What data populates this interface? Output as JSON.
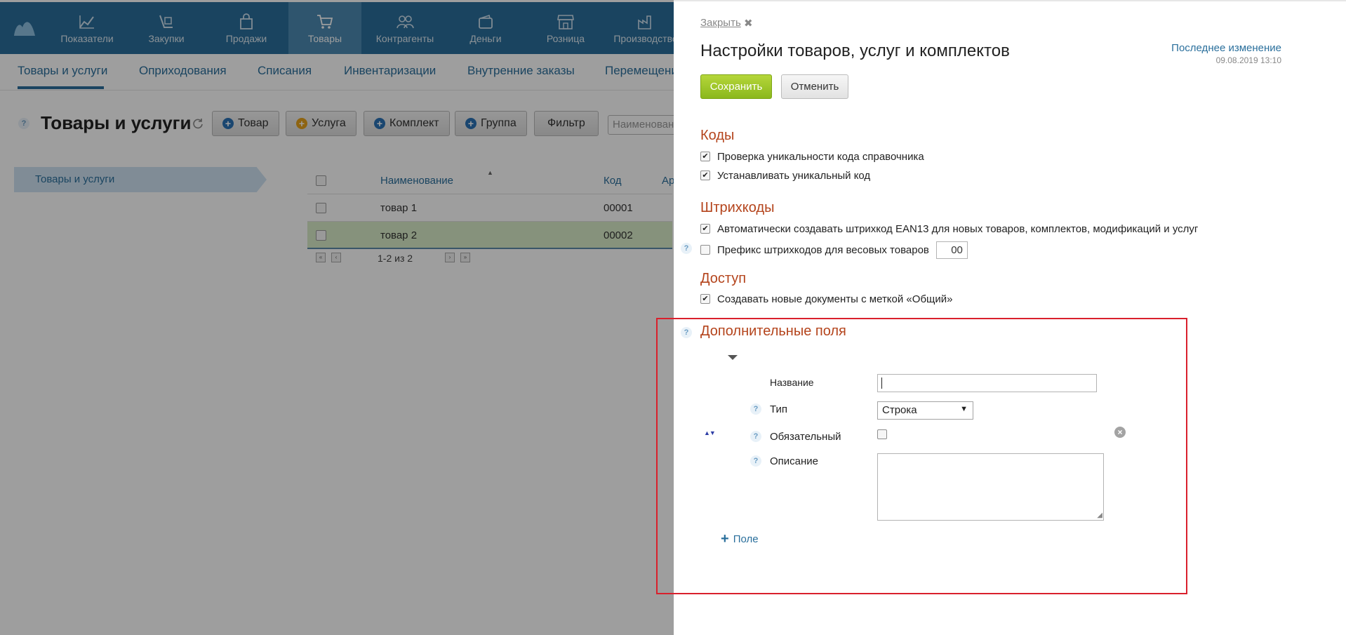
{
  "topnav": {
    "items": [
      {
        "label": "Показатели",
        "icon": "chart-icon"
      },
      {
        "label": "Закупки",
        "icon": "cart-dolly-icon"
      },
      {
        "label": "Продажи",
        "icon": "bag-icon"
      },
      {
        "label": "Товары",
        "icon": "cart-icon"
      },
      {
        "label": "Контрагенты",
        "icon": "people-icon"
      },
      {
        "label": "Деньги",
        "icon": "wallet-icon"
      },
      {
        "label": "Розница",
        "icon": "store-icon"
      },
      {
        "label": "Производство",
        "icon": "factory-icon"
      }
    ],
    "active": "Товары"
  },
  "subnav": {
    "items": [
      "Товары и услуги",
      "Оприходования",
      "Списания",
      "Инвентаризации",
      "Внутренние заказы",
      "Перемещени"
    ]
  },
  "page": {
    "title": "Товары и услуги",
    "buttons": {
      "product": "Товар",
      "service": "Услуга",
      "bundle": "Комплект",
      "group": "Группа",
      "filter": "Фильтр"
    },
    "search_placeholder": "Наименован"
  },
  "folder_tree": {
    "root": "Товары и услуги"
  },
  "grid": {
    "columns": [
      "Наименование",
      "Код",
      "Ар"
    ],
    "rows": [
      {
        "name": "товар 1",
        "code": "00001"
      },
      {
        "name": "товар 2",
        "code": "00002"
      }
    ],
    "pager_text": "1-2 из 2"
  },
  "panel": {
    "close_label": "Закрыть",
    "title": "Настройки товаров, услуг и комплектов",
    "last_change_label": "Последнее изменение",
    "last_change_date": "09.08.2019 13:10",
    "save_label": "Сохранить",
    "cancel_label": "Отменить",
    "codes": {
      "title": "Коды",
      "check_unique": "Проверка уникальности кода справочника",
      "set_unique": "Устанавливать уникальный код"
    },
    "barcodes": {
      "title": "Штрихкоды",
      "auto_ean13": "Автоматически создавать штрихкод EAN13 для новых товаров, комплектов, модификаций и услуг",
      "prefix_label": "Префикс штрихкодов для весовых товаров",
      "prefix_value": "00"
    },
    "access": {
      "title": "Доступ",
      "general_tag": "Создавать новые документы с меткой «Общий»"
    },
    "extra_fields": {
      "title": "Дополнительные поля",
      "name_label": "Название",
      "type_label": "Тип",
      "type_value": "Строка",
      "required_label": "Обязательный",
      "description_label": "Описание",
      "add_field_label": "Поле"
    },
    "accent_color": "#b4441c",
    "highlight_frame_color": "#d9202c"
  }
}
